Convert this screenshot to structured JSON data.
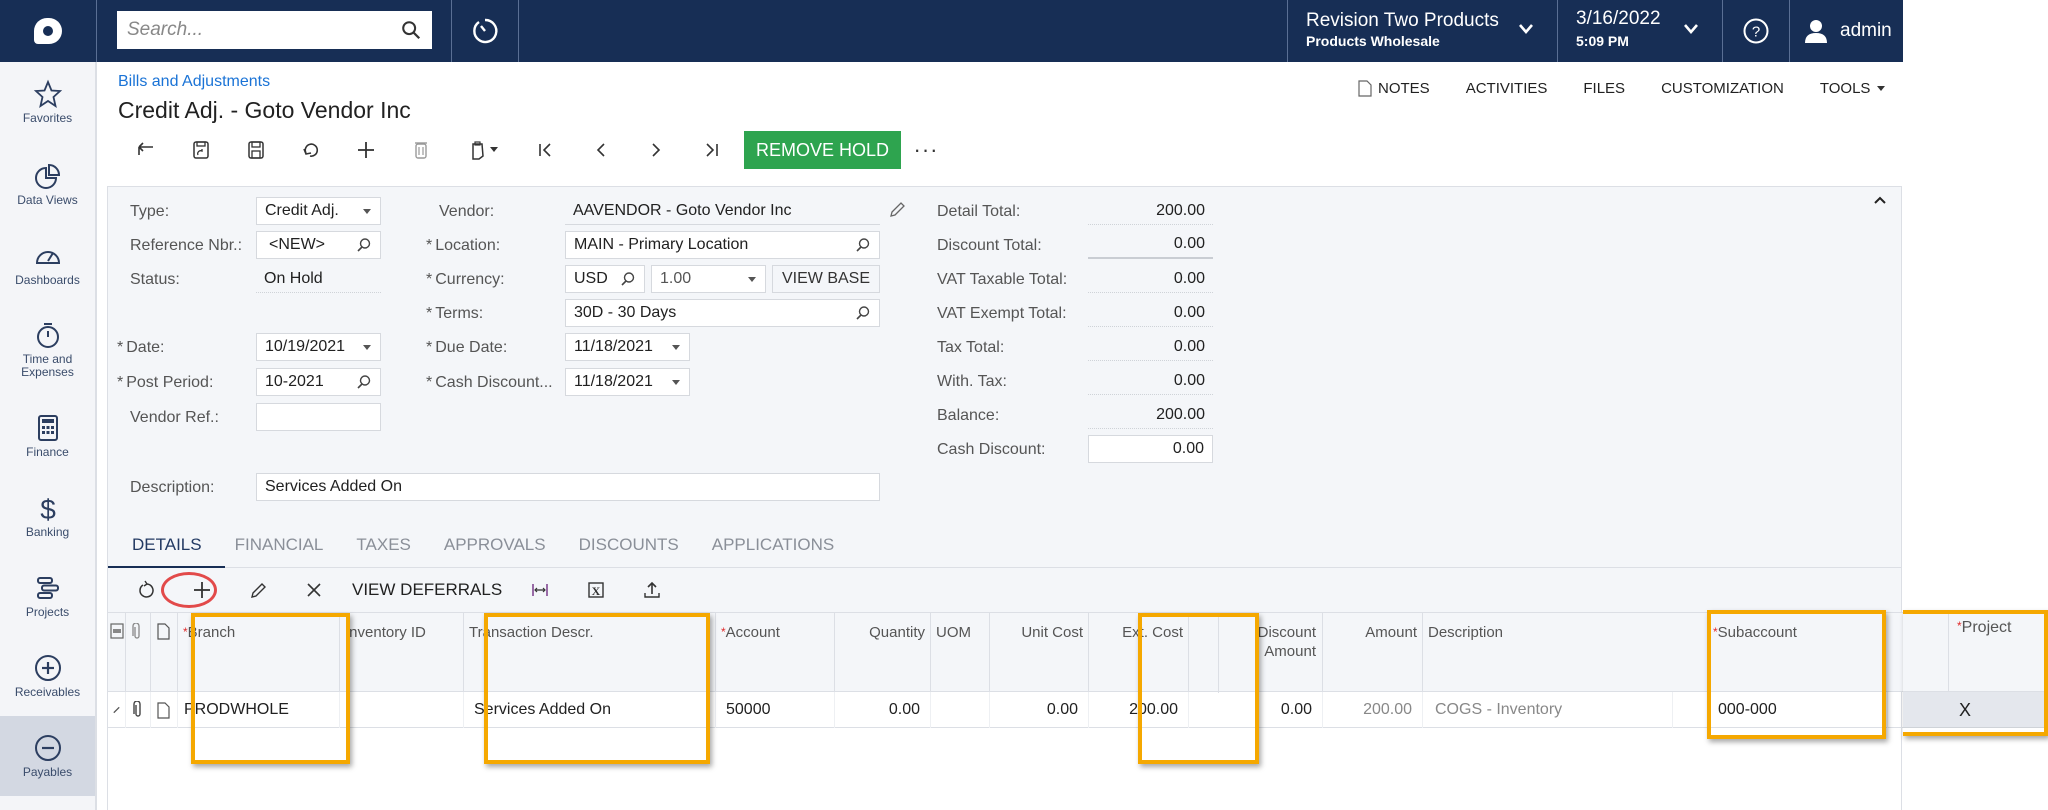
{
  "topbar": {
    "search_placeholder": "Search...",
    "company_name": "Revision Two Products",
    "branch_name": "Products Wholesale",
    "date": "3/16/2022",
    "time": "5:09 PM",
    "user": "admin"
  },
  "sidebar": {
    "items": [
      {
        "label": "Favorites",
        "icon": "star-icon"
      },
      {
        "label": "Data Views",
        "icon": "pie-chart-icon"
      },
      {
        "label": "Dashboards",
        "icon": "gauge-icon"
      },
      {
        "label": "Time and Expenses",
        "icon": "stopwatch-icon"
      },
      {
        "label": "Finance",
        "icon": "calculator-icon"
      },
      {
        "label": "Banking",
        "icon": "dollar-icon"
      },
      {
        "label": "Projects",
        "icon": "gantt-bars-icon"
      },
      {
        "label": "Receivables",
        "icon": "plus-circle-icon"
      },
      {
        "label": "Payables",
        "icon": "minus-circle-icon",
        "active": true
      }
    ]
  },
  "page": {
    "breadcrumb": "Bills and Adjustments",
    "title": "Credit Adj. - Goto Vendor Inc",
    "links": {
      "notes": "NOTES",
      "activities": "ACTIVITIES",
      "files": "FILES",
      "customization": "CUSTOMIZATION",
      "tools": "TOOLS"
    }
  },
  "toolbar": {
    "remove_hold": "REMOVE HOLD",
    "more": "···"
  },
  "form": {
    "type": {
      "label": "Type:",
      "value": "Credit Adj."
    },
    "reference_nbr": {
      "label": "Reference Nbr.:",
      "value": "<NEW>"
    },
    "status": {
      "label": "Status:",
      "value": "On Hold"
    },
    "date": {
      "label": "Date:",
      "value": "10/19/2021"
    },
    "post_period": {
      "label": "Post Period:",
      "value": "10-2021"
    },
    "vendor_ref": {
      "label": "Vendor Ref.:",
      "value": ""
    },
    "description": {
      "label": "Description:",
      "value": "Services Added On"
    },
    "vendor": {
      "label": "Vendor:",
      "value": "AAVENDOR - Goto Vendor Inc"
    },
    "location": {
      "label": "Location:",
      "value": "MAIN - Primary Location"
    },
    "currency": {
      "label": "Currency:",
      "value": "USD",
      "rate": "1.00",
      "view_base": "VIEW BASE"
    },
    "terms": {
      "label": "Terms:",
      "value": "30D - 30 Days"
    },
    "due_date": {
      "label": "Due Date:",
      "value": "11/18/2021"
    },
    "cash_discount_date": {
      "label": "Cash Discount...",
      "value": "11/18/2021"
    },
    "required_marker": "*"
  },
  "totals": {
    "detail_total": {
      "label": "Detail Total:",
      "value": "200.00"
    },
    "discount_total": {
      "label": "Discount Total:",
      "value": "0.00"
    },
    "vat_taxable_total": {
      "label": "VAT Taxable Total:",
      "value": "0.00"
    },
    "vat_exempt_total": {
      "label": "VAT Exempt Total:",
      "value": "0.00"
    },
    "tax_total": {
      "label": "Tax Total:",
      "value": "0.00"
    },
    "with_tax": {
      "label": "With. Tax:",
      "value": "0.00"
    },
    "balance": {
      "label": "Balance:",
      "value": "200.00"
    },
    "cash_discount": {
      "label": "Cash Discount:",
      "value": "0.00"
    }
  },
  "tabs": [
    {
      "label": "DETAILS",
      "active": true
    },
    {
      "label": "FINANCIAL"
    },
    {
      "label": "TAXES"
    },
    {
      "label": "APPROVALS"
    },
    {
      "label": "DISCOUNTS"
    },
    {
      "label": "APPLICATIONS"
    }
  ],
  "grid_toolbar": {
    "view_deferrals": "VIEW DEFERRALS"
  },
  "grid": {
    "columns": {
      "branch": "Branch",
      "inventory_id": "Inventory ID",
      "transaction_descr": "Transaction Descr.",
      "account": "Account",
      "quantity": "Quantity",
      "uom": "UOM",
      "unit_cost": "Unit Cost",
      "ext_cost": "Ext. Cost",
      "discount_amount": "Discount Amount",
      "amount": "Amount",
      "description": "Description",
      "subaccount": "Subaccount",
      "project": "Project"
    },
    "rows": [
      {
        "branch": "PRODWHOLE",
        "inventory_id": "",
        "transaction_descr": "Services Added On",
        "account": "50000",
        "quantity": "0.00",
        "uom": "",
        "unit_cost": "0.00",
        "ext_cost": "200.00",
        "discount_amount": "0.00",
        "amount": "200.00",
        "description": "COGS - Inventory",
        "subaccount": "000-000",
        "project": "X"
      }
    ]
  },
  "colors": {
    "topbar": "#172e55",
    "remove_hold": "#2ea44f",
    "highlight": "#f5a800",
    "annotation_circle": "#e24a4a",
    "link": "#1a73d6"
  }
}
